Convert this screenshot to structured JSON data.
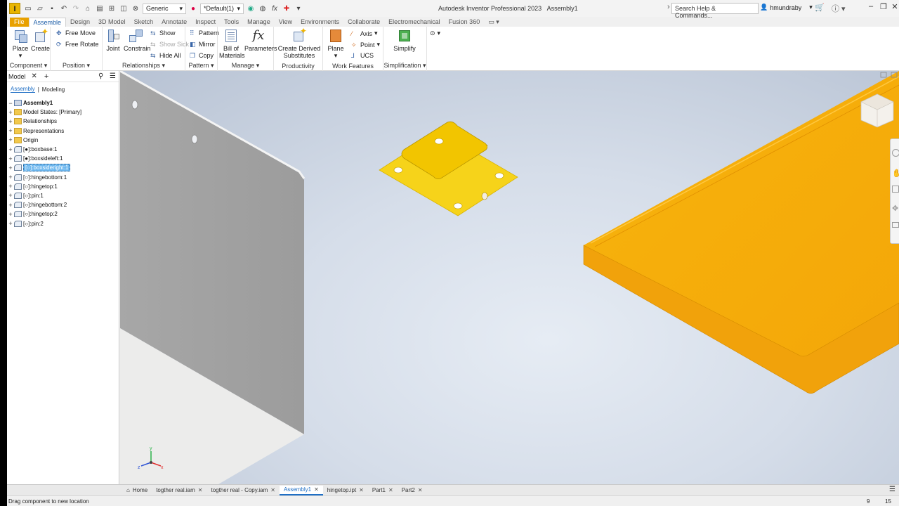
{
  "app": {
    "logo": "I",
    "title": "Autodesk Inventor Professional 2023",
    "document": "Assembly1"
  },
  "qat": {
    "material": "Generic",
    "appearance": "*Default(1)"
  },
  "search": {
    "placeholder": "Search Help & Commands..."
  },
  "user": {
    "name": "hmundraby"
  },
  "tabs": [
    "File",
    "Assemble",
    "Design",
    "3D Model",
    "Sketch",
    "Annotate",
    "Inspect",
    "Tools",
    "Manage",
    "View",
    "Environments",
    "Collaborate",
    "Electromechanical",
    "Fusion 360"
  ],
  "active_tab": "Assemble",
  "ribbon": {
    "component": {
      "label": "Component",
      "place": "Place",
      "create": "Create"
    },
    "position": {
      "label": "Position",
      "free_move": "Free Move",
      "free_rotate": "Free Rotate"
    },
    "relationships": {
      "label": "Relationships",
      "joint": "Joint",
      "constrain": "Constrain",
      "show": "Show",
      "show_sick": "Show Sick",
      "hide_all": "Hide All"
    },
    "pattern": {
      "label": "Pattern",
      "pattern": "Pattern",
      "mirror": "Mirror",
      "copy": "Copy"
    },
    "manage": {
      "label": "Manage",
      "bom_line1": "Bill of",
      "bom_line2": "Materials",
      "parameters": "Parameters"
    },
    "productivity": {
      "label": "Productivity",
      "line1": "Create Derived",
      "line2": "Substitutes"
    },
    "work_features": {
      "label": "Work Features",
      "plane": "Plane",
      "axis": "Axis",
      "point": "Point",
      "ucs": "UCS"
    },
    "simplification": {
      "label": "Simplification",
      "simplify": "Simplify"
    }
  },
  "browser": {
    "tab": "Model",
    "sub_tabs": [
      "Assembly",
      "Modeling"
    ],
    "root": "Assembly1",
    "nodes": [
      {
        "label": "Model States: [Primary]",
        "icon": "folder"
      },
      {
        "label": "Relationships",
        "icon": "folder"
      },
      {
        "label": "Representations",
        "icon": "folder"
      },
      {
        "label": "Origin",
        "icon": "folder"
      },
      {
        "label": "[●]:boxbase:1",
        "icon": "part"
      },
      {
        "label": "[●]:boxsideleft:1",
        "icon": "part"
      },
      {
        "label": "[○]:boxsideright:1",
        "icon": "part",
        "selected": true
      },
      {
        "label": "[○]:hingebottom:1",
        "icon": "part"
      },
      {
        "label": "[○]:hingetop:1",
        "icon": "part"
      },
      {
        "label": "[○]:pin:1",
        "icon": "part"
      },
      {
        "label": "[○]:hingebottom:2",
        "icon": "part"
      },
      {
        "label": "[○]:hingetop:2",
        "icon": "part"
      },
      {
        "label": "[○]:pin:2",
        "icon": "part"
      }
    ]
  },
  "doc_tabs": [
    {
      "label": "Home",
      "home": true
    },
    {
      "label": "togther real.iam"
    },
    {
      "label": "togther real - Copy.iam"
    },
    {
      "label": "Assembly1",
      "active": true
    },
    {
      "label": "hingetop.ipt"
    },
    {
      "label": "Part1"
    },
    {
      "label": "Part2"
    }
  ],
  "status": {
    "message": "Drag component to new location",
    "count1": "9",
    "count2": "15"
  },
  "colors": {
    "accent": "#1f6fc5",
    "file_tab": "#e8a100",
    "part_orange": "#f2a60a",
    "hinge_yellow": "#f6d31a"
  }
}
